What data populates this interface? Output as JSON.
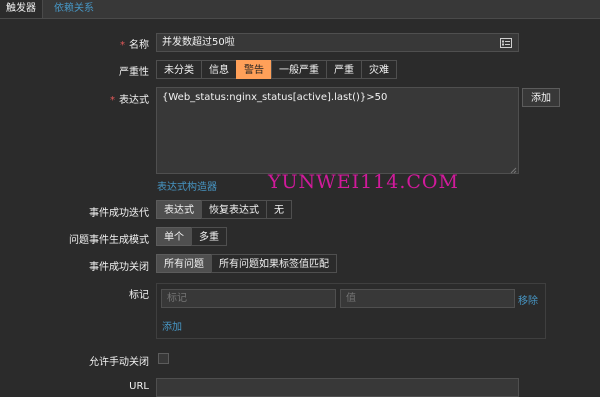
{
  "tabs": {
    "trigger": "触发器",
    "dependencies": "依赖关系"
  },
  "form": {
    "name": {
      "label": "名称",
      "value": "并发数超过50啦",
      "icon": "list-icon"
    },
    "severity": {
      "label": "严重性",
      "options": [
        "未分类",
        "信息",
        "警告",
        "一般严重",
        "严重",
        "灾难"
      ],
      "selected": "警告"
    },
    "expression": {
      "label": "表达式",
      "value": "{Web_status:nginx_status[active].last()}>50",
      "add_button": "添加",
      "builder_link": "表达式构造器"
    },
    "ok_event_generation": {
      "label": "事件成功迭代",
      "options": [
        "表达式",
        "恢复表达式",
        "无"
      ],
      "selected": "表达式"
    },
    "problem_event_mode": {
      "label": "问题事件生成模式",
      "options": [
        "单个",
        "多重"
      ],
      "selected": "单个"
    },
    "ok_event_closes": {
      "label": "事件成功关闭",
      "options": [
        "所有问题",
        "所有问题如果标签值匹配"
      ],
      "selected": "所有问题"
    },
    "tags": {
      "label": "标记",
      "tag_placeholder": "标记",
      "value_placeholder": "值",
      "remove_link": "移除",
      "add_link": "添加"
    },
    "manual_close": {
      "label": "允许手动关闭",
      "checked": false
    },
    "url": {
      "label": "URL",
      "value": ""
    }
  },
  "watermark": "YUNWEI114.COM",
  "colors": {
    "accent": "#4796c4",
    "warning": "#ffa059",
    "required": "#e45959",
    "watermark": "#d11a9b"
  }
}
